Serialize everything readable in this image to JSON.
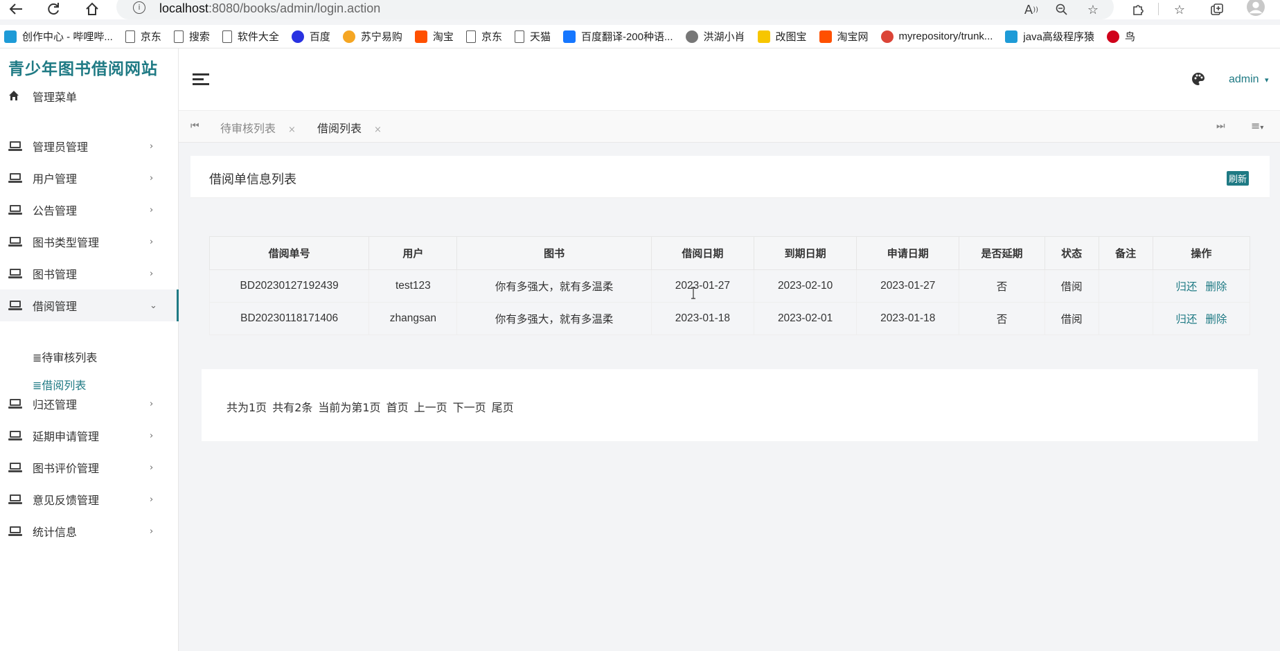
{
  "browser": {
    "url_host": "localhost",
    "url_path": ":8080/books/admin/login.action",
    "bookmarks": [
      {
        "label": "创作中心 - 哔哩哔...",
        "icon": "bilibili-icon",
        "color": "#1e9bd7"
      },
      {
        "label": "京东",
        "icon": "doc-icon",
        "color": "#555555"
      },
      {
        "label": "搜索",
        "icon": "doc-icon",
        "color": "#555555"
      },
      {
        "label": "软件大全",
        "icon": "doc-icon",
        "color": "#555555"
      },
      {
        "label": "百度",
        "icon": "baidu-icon",
        "color": "#2932e1"
      },
      {
        "label": "苏宁易购",
        "icon": "suning-icon",
        "color": "#f5a623"
      },
      {
        "label": "淘宝",
        "icon": "taobao-icon",
        "color": "#ff5000"
      },
      {
        "label": "京东",
        "icon": "doc-icon",
        "color": "#555555"
      },
      {
        "label": "天猫",
        "icon": "doc-icon",
        "color": "#555555"
      },
      {
        "label": "百度翻译-200种语...",
        "icon": "translate-icon",
        "color": "#1677ff"
      },
      {
        "label": "洪湖小肖",
        "icon": "bird-icon",
        "color": "#777777"
      },
      {
        "label": "改图宝",
        "icon": "gaitubao-icon",
        "color": "#f7c600"
      },
      {
        "label": "淘宝网",
        "icon": "taobao-icon",
        "color": "#ff5000"
      },
      {
        "label": "myrepository/trunk...",
        "icon": "chrome-icon",
        "color": "#db4437"
      },
      {
        "label": "java高级程序猿",
        "icon": "bilibili-icon",
        "color": "#1e9bd7"
      },
      {
        "label": "鸟",
        "icon": "bird-red-icon",
        "color": "#d0021b"
      }
    ]
  },
  "app": {
    "logo": "青少年图书借阅网站",
    "menu_header": "管理菜单",
    "menu": [
      {
        "label": "管理员管理"
      },
      {
        "label": "用户管理"
      },
      {
        "label": "公告管理"
      },
      {
        "label": "图书类型管理"
      },
      {
        "label": "图书管理"
      },
      {
        "label": "借阅管理"
      },
      {
        "label": "归还管理"
      },
      {
        "label": "延期申请管理"
      },
      {
        "label": "图书评价管理"
      },
      {
        "label": "意见反馈管理"
      },
      {
        "label": "统计信息"
      }
    ],
    "submenu": [
      "≣待审核列表",
      "≣借阅列表"
    ],
    "user": "admin",
    "accent_color": "#1f7a84"
  },
  "tabs": [
    {
      "label": "待审核列表",
      "close": "×"
    },
    {
      "label": "借阅列表",
      "close": "×"
    }
  ],
  "panel": {
    "title": "借阅单信息列表",
    "refresh_label": "刷新"
  },
  "table": {
    "headers": [
      "借阅单号",
      "用户",
      "图书",
      "借阅日期",
      "到期日期",
      "申请日期",
      "是否延期",
      "状态",
      "备注",
      "操作"
    ],
    "rows": [
      {
        "id": "BD20230127192439",
        "user": "test123",
        "book": "你有多强大，就有多温柔",
        "borrow_date": "2023-01-27",
        "due_date": "2023-02-10",
        "apply_date": "2023-01-27",
        "extended": "否",
        "status": "借阅",
        "note": "",
        "op_return": "归还",
        "op_delete": "删除"
      },
      {
        "id": "BD20230118171406",
        "user": "zhangsan",
        "book": "你有多强大，就有多温柔",
        "borrow_date": "2023-01-18",
        "due_date": "2023-02-01",
        "apply_date": "2023-01-18",
        "extended": "否",
        "status": "借阅",
        "note": "",
        "op_return": "归还",
        "op_delete": "删除"
      }
    ]
  },
  "pager": {
    "total_pages": "共为1页",
    "total_items": "共有2条",
    "current": "当前为第1页",
    "first": "首页",
    "prev": "上一页",
    "next": "下一页",
    "last": "尾页"
  }
}
